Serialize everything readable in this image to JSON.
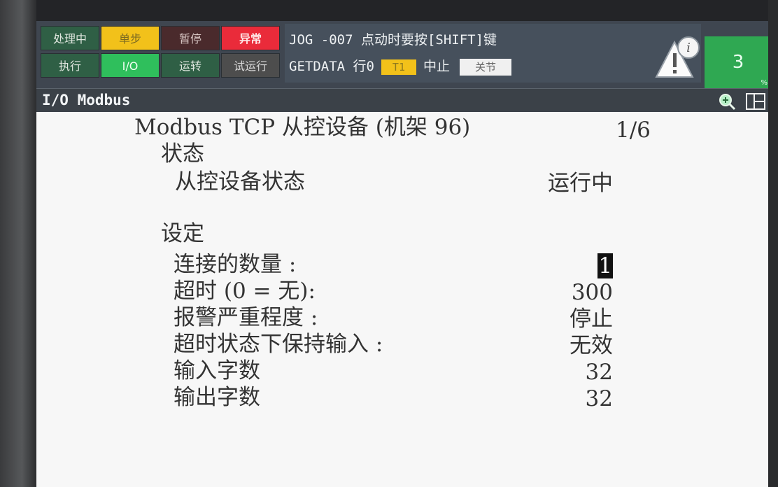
{
  "status_buttons": {
    "row1": [
      "处理中",
      "单步",
      "暂停",
      "异常"
    ],
    "row2": [
      "执行",
      "I/O",
      "运转",
      "试运行"
    ]
  },
  "message": {
    "line1": "JOG -007 点动时要按[SHIFT]键",
    "line2_prefix": "GETDATA 行0",
    "t1": "T1",
    "line2_mid": "中止",
    "line2_off": "关节"
  },
  "top_right": {
    "main": "3",
    "sub": "%"
  },
  "header": {
    "title": "I/O Modbus"
  },
  "icons": {
    "alert": "warning-info-icon",
    "zoom": "zoom-in-icon",
    "layout": "screen-split-icon"
  },
  "colors": {
    "green_active": "#2fbf5c",
    "yellow": "#f2c11a",
    "red_alarm": "#ea2b3a",
    "panel": "#3f4650"
  },
  "page": {
    "heading": "Modbus TCP 从控设备 (机架 96)",
    "page_number": "1/6",
    "status_section": "状态",
    "slave_status_label": "从控设备状态",
    "slave_status_value": "运行中",
    "settings_section": "设定",
    "rows": [
      {
        "label": "连接的数量        :",
        "value": "1"
      },
      {
        "label": "超时  (0 = 无):",
        "value": "300"
      },
      {
        "label": "报警严重程度      :",
        "value": "停止"
      },
      {
        "label": "超时状态下保持输入 :",
        "value": "无效"
      },
      {
        "label": "输入字数",
        "value": "32"
      },
      {
        "label": "输出字数",
        "value": "32"
      }
    ]
  }
}
